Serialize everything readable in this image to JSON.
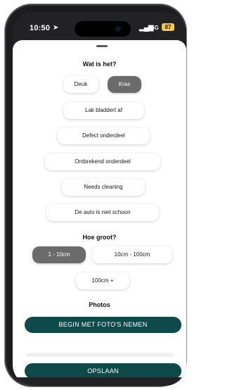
{
  "status_bar": {
    "time": "10:50",
    "location_icon": "location-arrow-icon",
    "signal_icon": "signal-bars-icon",
    "network": "5G",
    "battery": "87",
    "battery_color": "#F2C94C"
  },
  "damage_type": {
    "heading": "Wat is het?",
    "options": [
      {
        "label": "Deuk",
        "selected": false
      },
      {
        "label": "Kras",
        "selected": true
      },
      {
        "label": "Lak bladdert af",
        "selected": false
      },
      {
        "label": "Defect onderdeel",
        "selected": false
      },
      {
        "label": "Ontbrekend onderdeel",
        "selected": false
      },
      {
        "label": "Needs cleaning",
        "selected": false
      },
      {
        "label": "De auto is niet schoon",
        "selected": false
      }
    ]
  },
  "size": {
    "heading": "Hoe groot?",
    "options": [
      {
        "label": "1 - 10cm",
        "selected": true
      },
      {
        "label": "10cm - 100cm",
        "selected": false
      },
      {
        "label": "100cm +",
        "selected": false
      }
    ]
  },
  "photos": {
    "heading": "Photos",
    "button_label": "BEGIN MET FOTO'S NEMEN"
  },
  "save_button_label": "OPSLAAN",
  "colors": {
    "primary": "#0F4A4A",
    "selected_pill": "#6B6B6B"
  }
}
